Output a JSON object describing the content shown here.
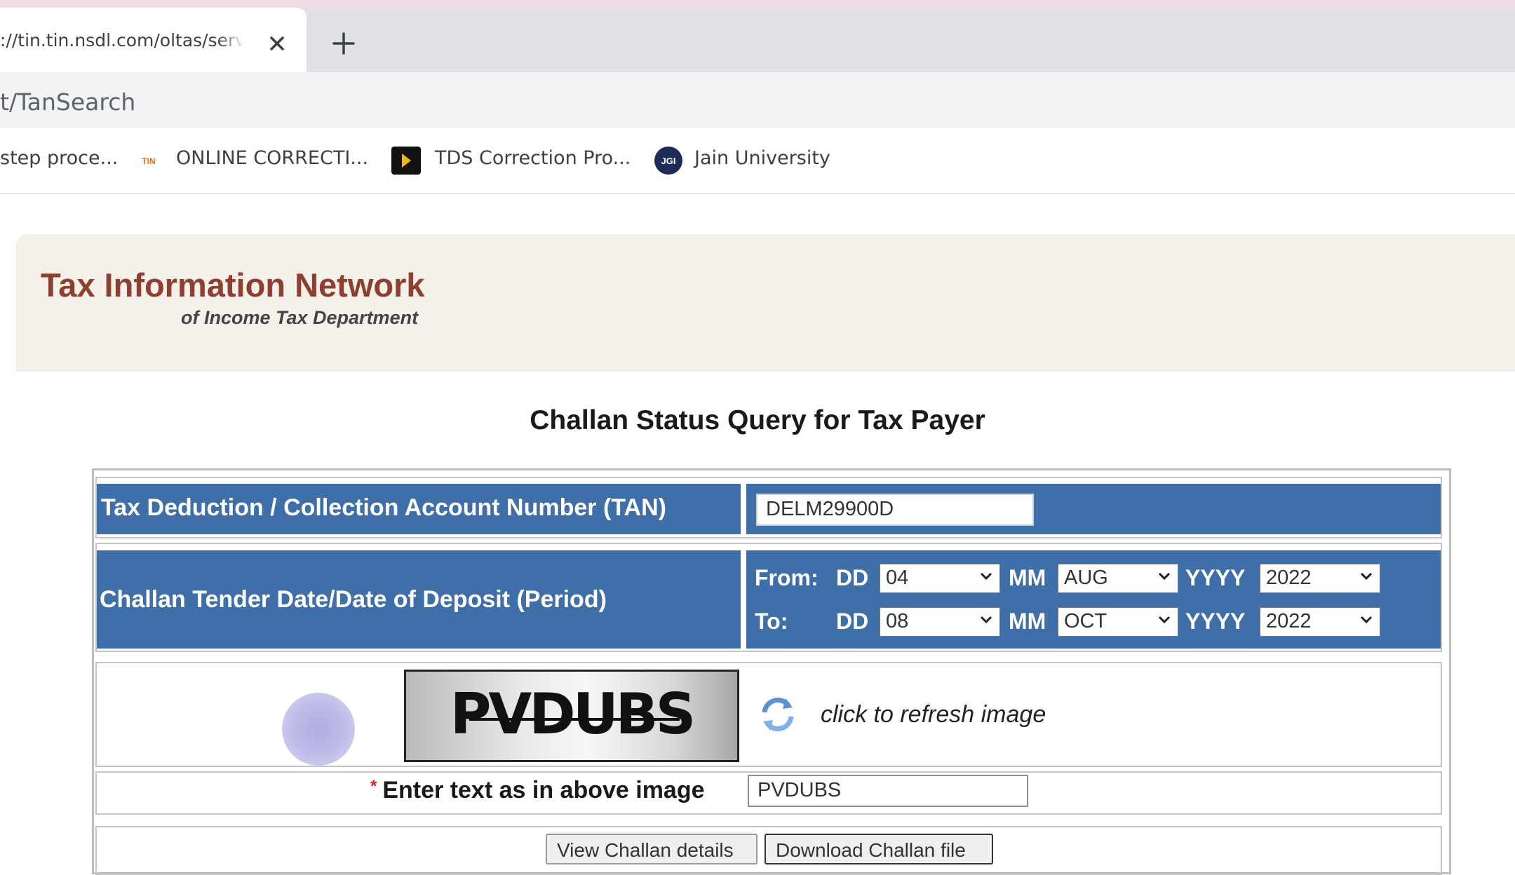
{
  "browser": {
    "tab_title": "://tin.tin.nsdl.com/oltas/servlet/TanSearch",
    "new_tab_symbol": "+",
    "url_fragment": "t/TanSearch",
    "bookmarks": [
      {
        "label": "step proce...",
        "icon": "none"
      },
      {
        "label": "ONLINE CORRECTI...",
        "icon": "tin-logo-icon",
        "icon_text": "TIN"
      },
      {
        "label": "TDS Correction Pro...",
        "icon": "play-bookmark-icon"
      },
      {
        "label": "Jain University",
        "icon": "jgi-logo-icon",
        "icon_text": "JGI"
      }
    ]
  },
  "header": {
    "title": "Tax Information Network",
    "subtitle": "of Income Tax Department"
  },
  "page": {
    "heading": "Challan Status Query for Tax Payer"
  },
  "form": {
    "tan_label": "Tax Deduction / Collection Account Number (TAN)",
    "tan_value": "DELM29900D",
    "period_label": "Challan Tender Date/Date of Deposit (Period)",
    "from_label": "From:",
    "to_label": "To:",
    "dd_label": "DD",
    "mm_label": "MM",
    "yyyy_label": "YYYY",
    "from": {
      "dd": "04",
      "mm": "AUG",
      "yyyy": "2022"
    },
    "to": {
      "dd": "08",
      "mm": "OCT",
      "yyyy": "2022"
    },
    "captcha_text": "PVDUBS",
    "refresh_text": "click to refresh image",
    "required_mark": "*",
    "captcha_input_label": "Enter text as in above image",
    "captcha_input_value": "PVDUBS",
    "view_button": "View Challan details",
    "download_button": "Download Challan file"
  },
  "colors": {
    "row_blue": "#3e6fa8",
    "brand_red": "#8e3f2f",
    "banner_bg": "#f3f1e9",
    "required_red": "#e02020"
  }
}
